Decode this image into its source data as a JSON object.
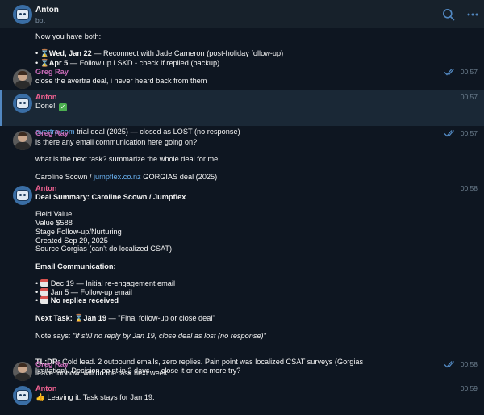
{
  "header": {
    "title": "Anton",
    "subtitle": "bot",
    "search_icon": "search-icon",
    "menu_icon": "more-horizontal-icon"
  },
  "colors": {
    "bot_name": "#f06292",
    "user_name": "#c96bb8",
    "link": "#6ab3f3",
    "read_check": "#5288c1"
  },
  "messages": {
    "m0": {
      "l1": "Now you have both:",
      "l2_date": "Wed, Jan 22",
      "l2_text": " — Reconnect with Jade Cameron (post-holiday follow-up)",
      "l3_date": "Apr 5",
      "l3_text": " — Follow up LSKD - check if replied (backup)"
    },
    "m1": {
      "name": "Greg Ray",
      "time": "00:57",
      "text": "close the avertra deal, i never heard back from them"
    },
    "m2": {
      "name": "Anton",
      "time": "00:57",
      "l1": "Done!",
      "link": "avertra.com",
      "l2": " trial deal (2025) — closed as LOST (no response)"
    },
    "m3": {
      "name": "Greg Ray",
      "time": "00:57",
      "l1": "is there any email communication here going on?",
      "l2": "what is the next task? summarize the whole deal for me",
      "l3a": "Caroline Scown / ",
      "link": "jumpflex.co.nz",
      "l3b": " GORGIAS deal (2025)"
    },
    "m4": {
      "name": "Anton",
      "time": "00:58",
      "summary_title": "Deal Summary: Caroline Scown / Jumpflex",
      "fields": [
        "Field Value",
        "Value $588",
        "Stage Follow-up/Nurturing",
        "Created Sep 29, 2025",
        "Source Gorgias (can't do localized CSAT)"
      ],
      "email_heading": "Email Communication:",
      "email1": "Dec 19 — Initial re-engagement email",
      "email2": "Jan 5 — Follow-up email",
      "email3": "No replies received",
      "next_label": "Next Task:",
      "next_date": "Jan 19",
      "next_text": " — \"Final follow-up or close deal\"",
      "note_label": "Note says: ",
      "note_text": "\"If still no reply by Jan 19, close deal as lost (no response)\"",
      "tldr_label": "TL;DR:",
      "tldr_1": " Cold lead. 2 outbound emails, zero replies. Pain point was localized CSAT surveys (Gorgias",
      "tldr_2": "limitation). Decision point in 2 days — close it or one more try?"
    },
    "m5": {
      "name": "Greg Ray",
      "time": "00:58",
      "text": "leave for now. will do the task next week"
    },
    "m6": {
      "name": "Anton",
      "time": "00:59",
      "text": "Leaving it. Task stays for Jan 19."
    }
  }
}
